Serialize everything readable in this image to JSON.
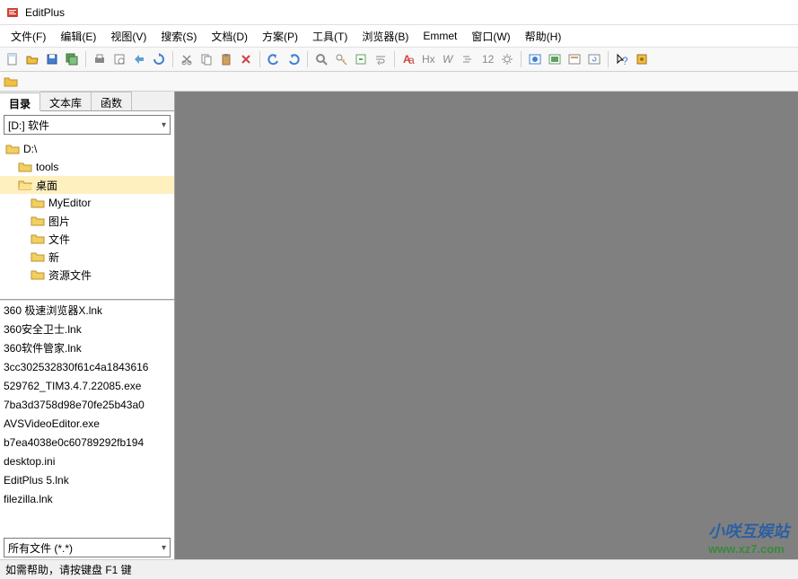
{
  "title": "EditPlus",
  "menubar": [
    {
      "label": "文件(F)",
      "key": "F"
    },
    {
      "label": "编辑(E)",
      "key": "E"
    },
    {
      "label": "视图(V)",
      "key": "V"
    },
    {
      "label": "搜索(S)",
      "key": "S"
    },
    {
      "label": "文档(D)",
      "key": "D"
    },
    {
      "label": "方案(P)",
      "key": "P"
    },
    {
      "label": "工具(T)",
      "key": "T"
    },
    {
      "label": "浏览器(B)",
      "key": "B"
    },
    {
      "label": "Emmet",
      "key": ""
    },
    {
      "label": "窗口(W)",
      "key": "W"
    },
    {
      "label": "帮助(H)",
      "key": "H"
    }
  ],
  "sidebar": {
    "tabs": [
      "目录",
      "文本库",
      "函数"
    ],
    "active_tab": 0,
    "drive": "[D:] 软件",
    "folders": [
      {
        "name": "D:\\",
        "level": 0,
        "selected": false
      },
      {
        "name": "tools",
        "level": 1,
        "selected": false
      },
      {
        "name": "桌面",
        "level": 1,
        "selected": true
      },
      {
        "name": "MyEditor",
        "level": 2,
        "selected": false
      },
      {
        "name": "图片",
        "level": 2,
        "selected": false
      },
      {
        "name": "文件",
        "level": 2,
        "selected": false
      },
      {
        "name": "新",
        "level": 2,
        "selected": false
      },
      {
        "name": "资源文件",
        "level": 2,
        "selected": false
      }
    ],
    "files": [
      "360 极速浏览器X.lnk",
      "360安全卫士.lnk",
      "360软件管家.lnk",
      "3cc302532830f61c4a1843616",
      "529762_TIM3.4.7.22085.exe",
      "7ba3d3758d98e70fe25b43a0",
      "AVSVideoEditor.exe",
      "b7ea4038e0c60789292fb194",
      "desktop.ini",
      "EditPlus 5.lnk",
      "filezilla.lnk"
    ],
    "filter": "所有文件 (*.*)"
  },
  "statusbar": "如需帮助，请按键盘 F1 键",
  "watermark": {
    "name": "小咲互娱站",
    "url": "www.xz7.com"
  }
}
